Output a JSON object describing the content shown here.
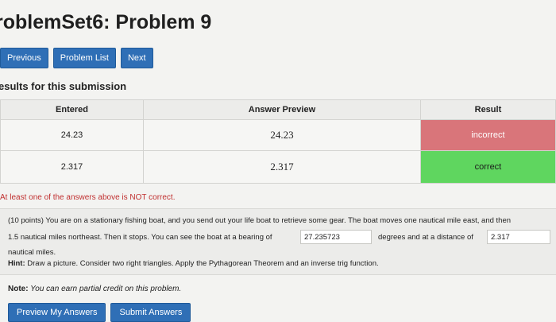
{
  "page": {
    "title": "roblemSet6: Problem 9"
  },
  "nav": {
    "previous": "Previous",
    "problem_list": "Problem List",
    "next": "Next"
  },
  "results": {
    "heading": "esults for this submission",
    "headers": {
      "entered": "Entered",
      "preview": "Answer Preview",
      "result": "Result"
    },
    "rows": [
      {
        "entered": "24.23",
        "preview": "24.23",
        "result": "incorrect"
      },
      {
        "entered": "2.317",
        "preview": "2.317",
        "result": "correct"
      }
    ],
    "colors": {
      "incorrect": "#d9757a",
      "correct": "#5fd65f"
    }
  },
  "warning": "At least one of the answers above is NOT correct.",
  "problem": {
    "line1": "(10 points) You are on a stationary fishing boat, and you send out your life boat to retrieve some gear. The boat moves one nautical mile east, and then",
    "line2_a": "1.5 nautical miles northeast. Then it stops. You can see the boat at a bearing of",
    "input1_value": "27.235723",
    "line2_b": "degrees and at a distance of",
    "input2_value": "2.317",
    "line3": "nautical miles.",
    "hint_label": "Hint:",
    "hint_text": " Draw a picture. Consider two right triangles. Apply the Pythagorean Theorem and an inverse trig function."
  },
  "note": {
    "label": "Note:",
    "text": " You can earn partial credit on this problem."
  },
  "actions": {
    "preview": "Preview My Answers",
    "submit": "Submit Answers"
  },
  "theme": {
    "button_blue": "#2f6fb6",
    "warning_red": "#c03030"
  }
}
